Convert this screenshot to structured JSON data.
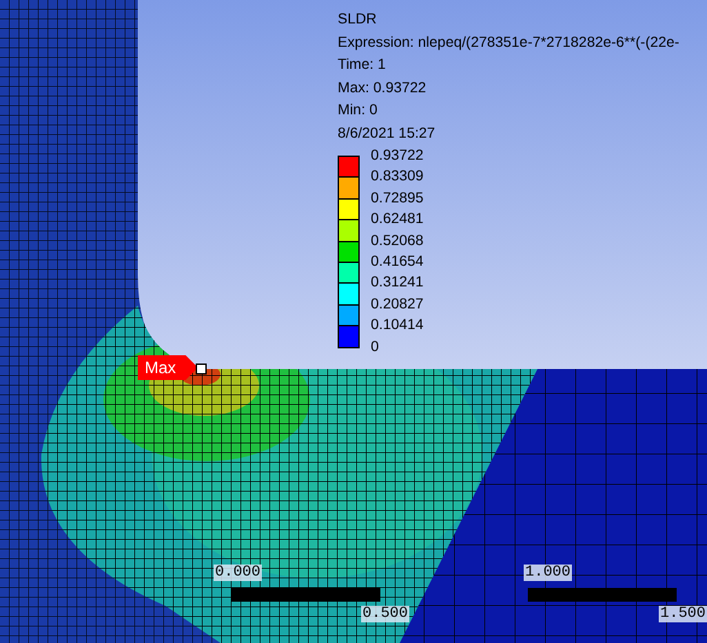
{
  "result": {
    "name": "SLDR",
    "expression": "Expression: nlepeq/(278351e-7*2718282e-6**(-(22e-",
    "time": "Time: 1",
    "max": "Max: 0.93722",
    "min": "Min: 0",
    "date": "8/6/2021 15:27"
  },
  "legend": {
    "levels": [
      "0.93722",
      "0.83309",
      "0.72895",
      "0.62481",
      "0.52068",
      "0.41654",
      "0.31241",
      "0.20827",
      "0.10414",
      "0"
    ],
    "bands": [
      {
        "color": "#ff0000"
      },
      {
        "color": "#ffaa00"
      },
      {
        "color": "#ffff00"
      },
      {
        "color": "#aaff00"
      },
      {
        "color": "#00e000"
      },
      {
        "color": "#00ffaa"
      },
      {
        "color": "#00ffff"
      },
      {
        "color": "#00aaff"
      },
      {
        "color": "#0000ff"
      }
    ]
  },
  "probe": {
    "label": "Max"
  },
  "scale": {
    "ticks": [
      "0.000",
      "0.500",
      "1.000",
      "1.500"
    ]
  }
}
